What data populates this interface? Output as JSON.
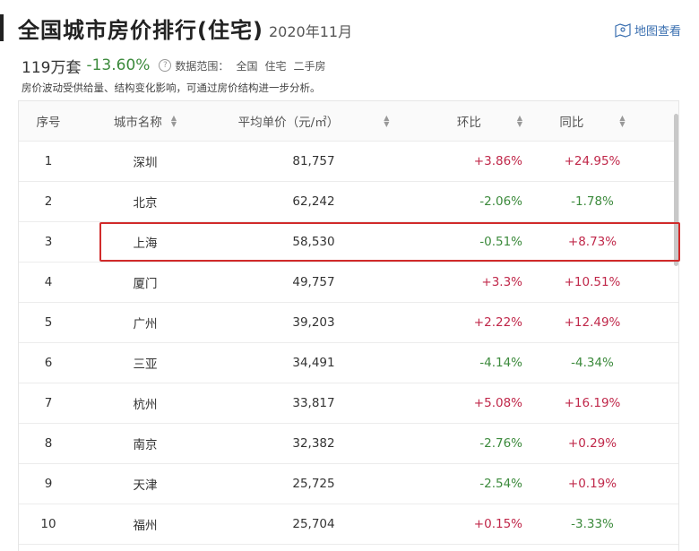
{
  "header": {
    "title": "全国城市房价排行(住宅)",
    "date": "2020年11月",
    "map_link": "地图查看"
  },
  "summary": {
    "total": "119万套",
    "change": "-13.60%",
    "scope_label": "数据范围：",
    "scope_items": [
      "全国",
      "住宅",
      "二手房"
    ],
    "note": "房价波动受供给量、结构变化影响，可通过房价结构进一步分析。"
  },
  "table": {
    "columns": [
      "序号",
      "城市名称",
      "平均单价（元/㎡）",
      "环比",
      "同比"
    ],
    "rows": [
      {
        "rank": "1",
        "city": "深圳",
        "price": "81,757",
        "mom": "+3.86%",
        "yoy": "+24.95%"
      },
      {
        "rank": "2",
        "city": "北京",
        "price": "62,242",
        "mom": "-2.06%",
        "yoy": "-1.78%"
      },
      {
        "rank": "3",
        "city": "上海",
        "price": "58,530",
        "mom": "-0.51%",
        "yoy": "+8.73%"
      },
      {
        "rank": "4",
        "city": "厦门",
        "price": "49,757",
        "mom": "+3.3%",
        "yoy": "+10.51%"
      },
      {
        "rank": "5",
        "city": "广州",
        "price": "39,203",
        "mom": "+2.22%",
        "yoy": "+12.49%"
      },
      {
        "rank": "6",
        "city": "三亚",
        "price": "34,491",
        "mom": "-4.14%",
        "yoy": "-4.34%"
      },
      {
        "rank": "7",
        "city": "杭州",
        "price": "33,817",
        "mom": "+5.08%",
        "yoy": "+16.19%"
      },
      {
        "rank": "8",
        "city": "南京",
        "price": "32,382",
        "mom": "-2.76%",
        "yoy": "+0.29%"
      },
      {
        "rank": "9",
        "city": "天津",
        "price": "25,725",
        "mom": "-2.54%",
        "yoy": "+0.19%"
      },
      {
        "rank": "10",
        "city": "福州",
        "price": "25,704",
        "mom": "+0.15%",
        "yoy": "-3.33%"
      }
    ]
  },
  "colors": {
    "increase": "#c0284a",
    "decrease": "#3c8a3c",
    "highlight_border": "#d12b2b"
  }
}
